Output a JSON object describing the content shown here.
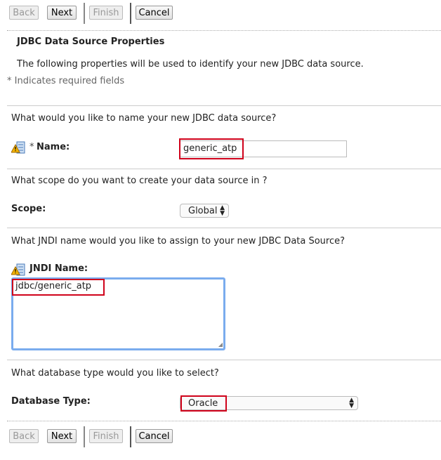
{
  "toolbar": {
    "back": "Back",
    "next": "Next",
    "finish": "Finish",
    "cancel": "Cancel"
  },
  "header": {
    "title": "JDBC Data Source Properties",
    "description": "The following properties will be used to identify your new JDBC data source.",
    "required_note": "* Indicates required fields"
  },
  "name_section": {
    "question": "What would you like to name your new JDBC data source?",
    "required_mark": "*",
    "label": "Name:",
    "value": "generic_atp"
  },
  "scope_section": {
    "question": "What scope do you want to create your data source in ?",
    "label": "Scope:",
    "value": "Global"
  },
  "jndi_section": {
    "question": "What JNDI name would you like to assign to your new JDBC Data Source?",
    "label": "JNDI Name:",
    "value": "jdbc/generic_atp"
  },
  "dbtype_section": {
    "question": "What database type would you like to select?",
    "label": "Database Type:",
    "value": "Oracle"
  },
  "colors": {
    "highlight": "#d0021b",
    "focus": "#7aacee"
  }
}
